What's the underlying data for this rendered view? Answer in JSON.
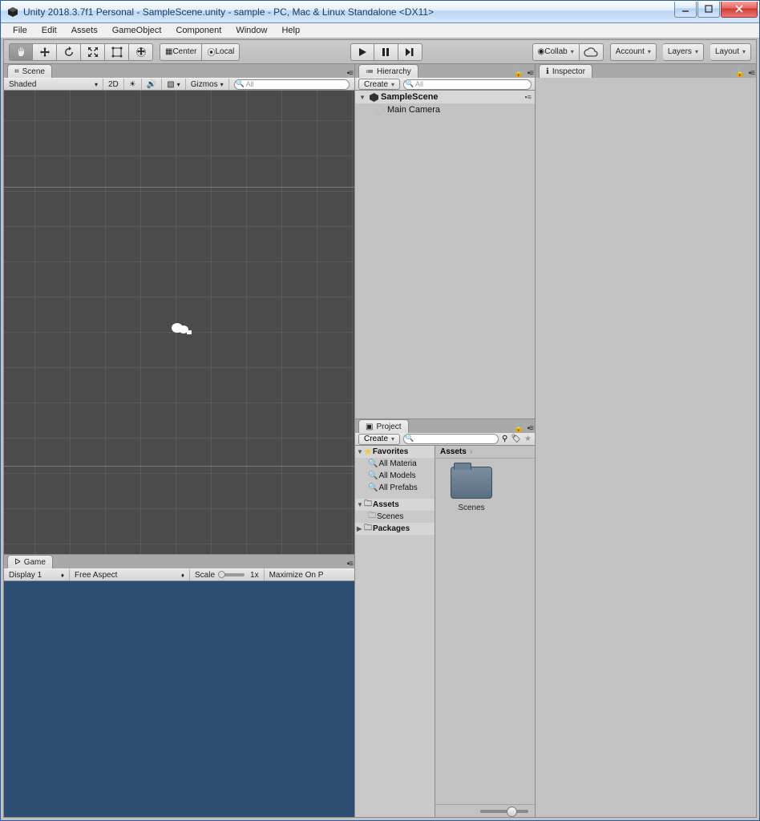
{
  "window": {
    "title": "Unity 2018.3.7f1 Personal - SampleScene.unity - sample - PC, Mac & Linux Standalone <DX11>"
  },
  "menubar": [
    "File",
    "Edit",
    "Assets",
    "GameObject",
    "Component",
    "Window",
    "Help"
  ],
  "toolbar": {
    "center_btn": "Center",
    "local_btn": "Local",
    "collab": "Collab",
    "account": "Account",
    "layers": "Layers",
    "layout": "Layout"
  },
  "scene": {
    "tab": "Scene",
    "shading": "Shaded",
    "twoD": "2D",
    "gizmos": "Gizmos",
    "search_ph": "All"
  },
  "game": {
    "tab": "Game",
    "display": "Display 1",
    "aspect": "Free Aspect",
    "scale_label": "Scale",
    "scale_val": "1x",
    "maximize": "Maximize On P"
  },
  "hierarchy": {
    "tab": "Hierarchy",
    "create": "Create",
    "search_ph": "All",
    "scene_name": "SampleScene",
    "items": [
      "Main Camera"
    ]
  },
  "project": {
    "tab": "Project",
    "create": "Create",
    "favorites_label": "Favorites",
    "favorites": [
      "All Materia",
      "All Models",
      "All Prefabs"
    ],
    "assets_label": "Assets",
    "assets_children": [
      "Scenes"
    ],
    "packages_label": "Packages",
    "breadcrumb": "Assets",
    "folder_name": "Scenes"
  },
  "inspector": {
    "tab": "Inspector"
  }
}
